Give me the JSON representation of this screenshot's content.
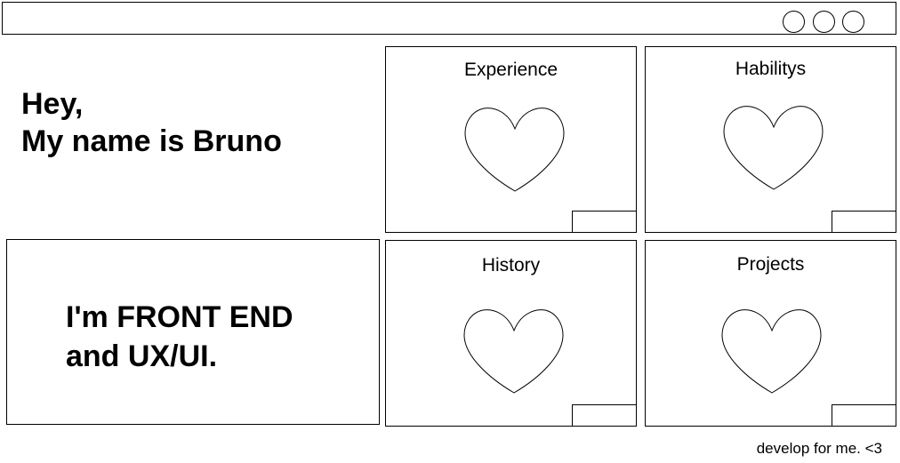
{
  "window": {
    "controls": [
      "circle-button",
      "circle-button",
      "circle-button"
    ]
  },
  "hero": {
    "line1": "Hey,",
    "line2": "My name is Bruno"
  },
  "role": {
    "line1": "I'm FRONT END",
    "line2": "and UX/UI."
  },
  "cards": [
    {
      "title": "Experience",
      "icon": "heart-icon"
    },
    {
      "title": "Habilitys",
      "icon": "heart-icon"
    },
    {
      "title": "History",
      "icon": "heart-icon"
    },
    {
      "title": "Projects",
      "icon": "heart-icon"
    }
  ],
  "footer": {
    "text": "develop for me. <3"
  }
}
